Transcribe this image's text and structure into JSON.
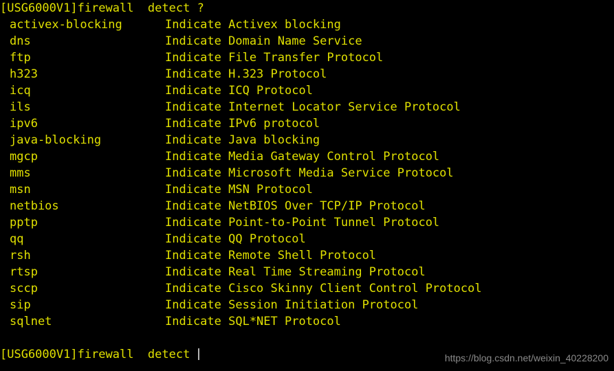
{
  "terminal": {
    "device": "USG6000V1",
    "prompt_top": "[USG6000V1]firewall  detect ?",
    "prompt_bottom": "[USG6000V1]firewall  detect ",
    "foreground_color": "#e0e000",
    "background_color": "#000000",
    "cursor_color": "#b4b4b4",
    "cursor_glyph": "text-cursor-bar"
  },
  "help_list": {
    "items": [
      {
        "keyword": "activex-blocking",
        "description": "Indicate Activex blocking"
      },
      {
        "keyword": "dns",
        "description": "Indicate Domain Name Service"
      },
      {
        "keyword": "ftp",
        "description": "Indicate File Transfer Protocol"
      },
      {
        "keyword": "h323",
        "description": "Indicate H.323 Protocol"
      },
      {
        "keyword": "icq",
        "description": "Indicate ICQ Protocol"
      },
      {
        "keyword": "ils",
        "description": "Indicate Internet Locator Service Protocol"
      },
      {
        "keyword": "ipv6",
        "description": "Indicate IPv6 protocol"
      },
      {
        "keyword": "java-blocking",
        "description": "Indicate Java blocking"
      },
      {
        "keyword": "mgcp",
        "description": "Indicate Media Gateway Control Protocol"
      },
      {
        "keyword": "mms",
        "description": "Indicate Microsoft Media Service Protocol"
      },
      {
        "keyword": "msn",
        "description": "Indicate MSN Protocol"
      },
      {
        "keyword": "netbios",
        "description": "Indicate NetBIOS Over TCP/IP Protocol"
      },
      {
        "keyword": "pptp",
        "description": "Indicate Point-to-Point Tunnel Protocol"
      },
      {
        "keyword": "qq",
        "description": "Indicate QQ Protocol"
      },
      {
        "keyword": "rsh",
        "description": "Indicate Remote Shell Protocol"
      },
      {
        "keyword": "rtsp",
        "description": "Indicate Real Time Streaming Protocol"
      },
      {
        "keyword": "sccp",
        "description": "Indicate Cisco Skinny Client Control Protocol"
      },
      {
        "keyword": "sip",
        "description": "Indicate Session Initiation Protocol"
      },
      {
        "keyword": "sqlnet",
        "description": "Indicate SQL*NET Protocol"
      }
    ]
  },
  "watermark": {
    "text": "https://blog.csdn.net/weixin_40228200"
  }
}
